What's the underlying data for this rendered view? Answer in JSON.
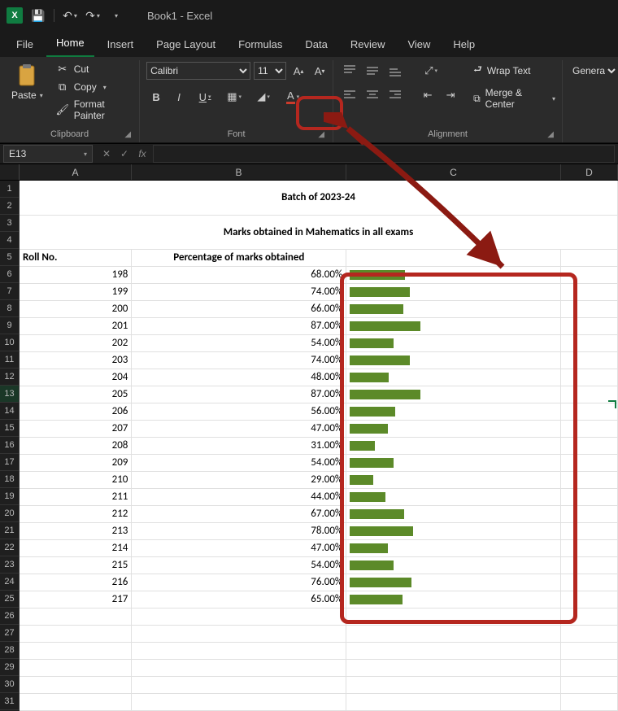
{
  "app": {
    "title": "Book1 - Excel"
  },
  "qat": {
    "save": "💾",
    "undo": "↶",
    "redo": "↷"
  },
  "menu": {
    "file": "File",
    "home": "Home",
    "insert": "Insert",
    "pagelayout": "Page Layout",
    "formulas": "Formulas",
    "data": "Data",
    "review": "Review",
    "view": "View",
    "help": "Help"
  },
  "ribbon": {
    "clipboard": {
      "label": "Clipboard",
      "paste": "Paste",
      "cut": "Cut",
      "copy": "Copy",
      "format_painter": "Format Painter"
    },
    "font": {
      "label": "Font",
      "name": "Calibri",
      "size": "11",
      "bold": "B",
      "italic": "I",
      "underline": "U"
    },
    "alignment": {
      "label": "Alignment",
      "wrap": "Wrap Text",
      "merge": "Merge & Center"
    },
    "number": {
      "format": "General"
    }
  },
  "namebox": "E13",
  "fx": {
    "cancel": "✕",
    "enter": "✓",
    "fx": "fx"
  },
  "columns": [
    "A",
    "B",
    "C",
    "D"
  ],
  "col_widths": {
    "A": 138,
    "B": 264,
    "C": 264,
    "D": 70
  },
  "title_row": "Batch of 2023-24",
  "subtitle_row": "Marks obtained in Mahematics in all exams",
  "headers": {
    "A": "Roll No.",
    "B": "Percentage of marks obtained",
    "C": ""
  },
  "rows": [
    {
      "n": 6,
      "roll": 198,
      "pct": "68.00%",
      "val": 68
    },
    {
      "n": 7,
      "roll": 199,
      "pct": "74.00%",
      "val": 74
    },
    {
      "n": 8,
      "roll": 200,
      "pct": "66.00%",
      "val": 66
    },
    {
      "n": 9,
      "roll": 201,
      "pct": "87.00%",
      "val": 87
    },
    {
      "n": 10,
      "roll": 202,
      "pct": "54.00%",
      "val": 54
    },
    {
      "n": 11,
      "roll": 203,
      "pct": "74.00%",
      "val": 74
    },
    {
      "n": 12,
      "roll": 204,
      "pct": "48.00%",
      "val": 48
    },
    {
      "n": 13,
      "roll": 205,
      "pct": "87.00%",
      "val": 87
    },
    {
      "n": 14,
      "roll": 206,
      "pct": "56.00%",
      "val": 56
    },
    {
      "n": 15,
      "roll": 207,
      "pct": "47.00%",
      "val": 47
    },
    {
      "n": 16,
      "roll": 208,
      "pct": "31.00%",
      "val": 31
    },
    {
      "n": 17,
      "roll": 209,
      "pct": "54.00%",
      "val": 54
    },
    {
      "n": 18,
      "roll": 210,
      "pct": "29.00%",
      "val": 29
    },
    {
      "n": 19,
      "roll": 211,
      "pct": "44.00%",
      "val": 44
    },
    {
      "n": 20,
      "roll": 212,
      "pct": "67.00%",
      "val": 67
    },
    {
      "n": 21,
      "roll": 213,
      "pct": "78.00%",
      "val": 78
    },
    {
      "n": 22,
      "roll": 214,
      "pct": "47.00%",
      "val": 47
    },
    {
      "n": 23,
      "roll": 215,
      "pct": "54.00%",
      "val": 54
    },
    {
      "n": 24,
      "roll": 216,
      "pct": "76.00%",
      "val": 76
    },
    {
      "n": 25,
      "roll": 217,
      "pct": "65.00%",
      "val": 65
    }
  ],
  "empty_rows_after": 6,
  "selected_row": 13,
  "chart_data": {
    "type": "bar",
    "title": "Marks obtained in Mahematics in all exams — Batch of 2023-24",
    "xlabel": "Roll No.",
    "ylabel": "Percentage of marks obtained",
    "categories": [
      198,
      199,
      200,
      201,
      202,
      203,
      204,
      205,
      206,
      207,
      208,
      209,
      210,
      211,
      212,
      213,
      214,
      215,
      216,
      217
    ],
    "values": [
      68,
      74,
      66,
      87,
      54,
      74,
      48,
      87,
      56,
      47,
      31,
      54,
      29,
      44,
      67,
      78,
      47,
      54,
      76,
      65
    ],
    "ylim": [
      0,
      100
    ]
  }
}
